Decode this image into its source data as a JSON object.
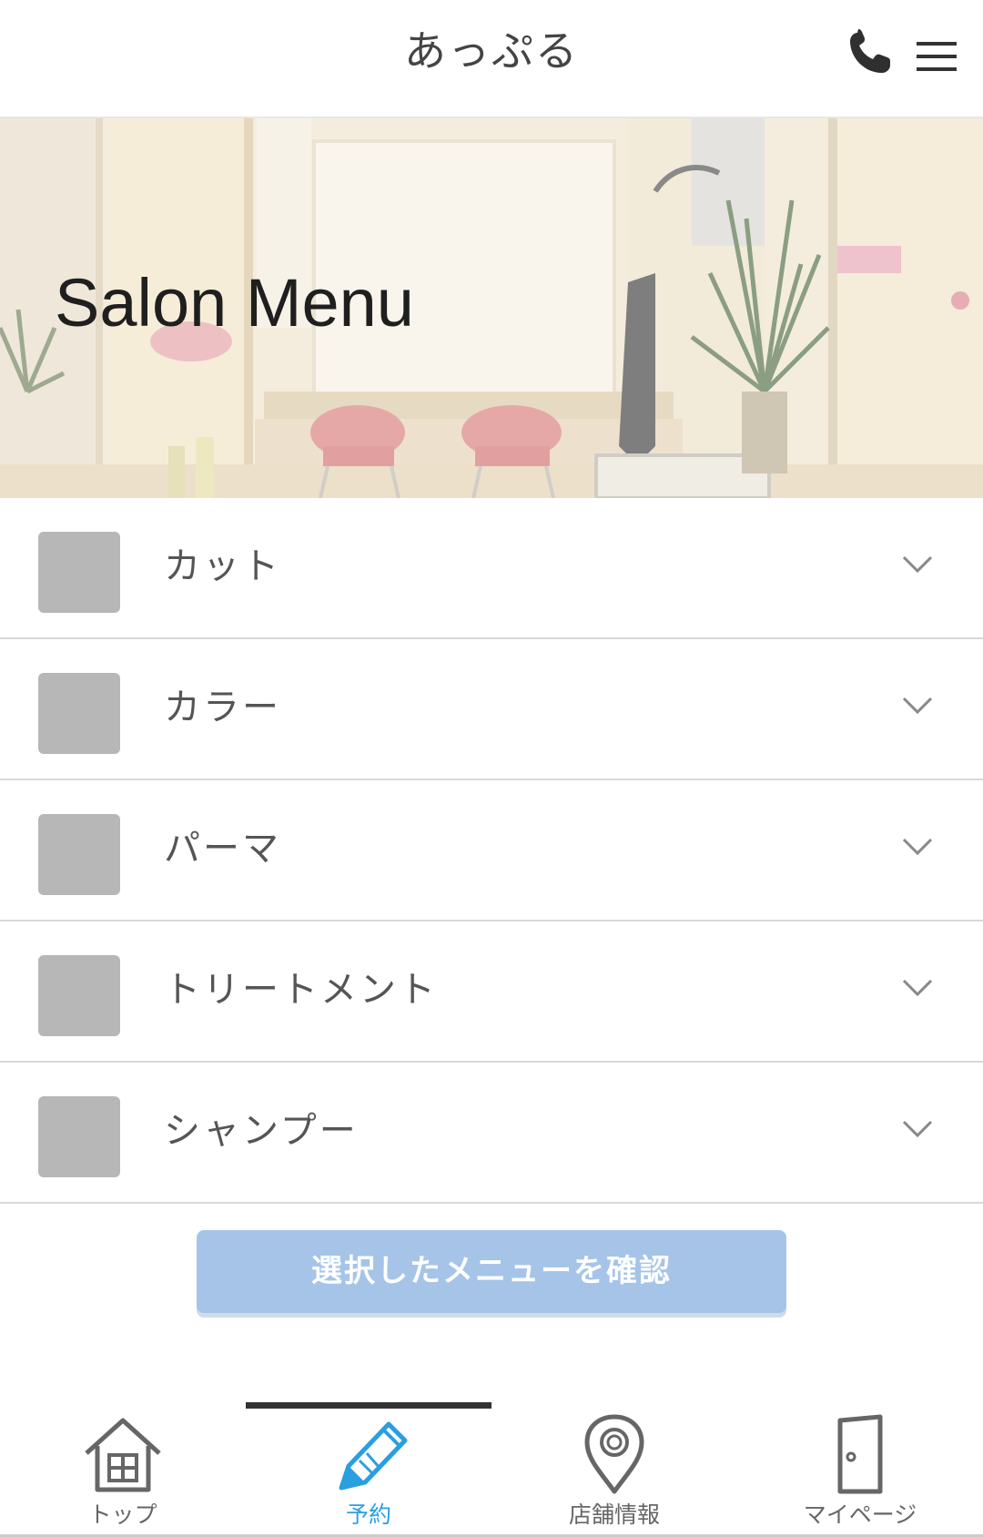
{
  "header": {
    "title": "あっぷる",
    "phone_icon": "phone-icon",
    "menu_icon": "hamburger-menu-icon"
  },
  "hero": {
    "title": "Salon Menu"
  },
  "menu": {
    "items": [
      {
        "label": "カット"
      },
      {
        "label": "カラー"
      },
      {
        "label": "パーマ"
      },
      {
        "label": "トリートメント"
      },
      {
        "label": "シャンプー"
      }
    ],
    "expand_icon": "chevron-down-icon"
  },
  "confirm": {
    "label": "選択したメニューを確認"
  },
  "tabs": [
    {
      "label": "トップ",
      "icon": "home-icon",
      "active": false
    },
    {
      "label": "予約",
      "icon": "pencil-icon",
      "active": true
    },
    {
      "label": "店舗情報",
      "icon": "map-pin-icon",
      "active": false
    },
    {
      "label": "マイページ",
      "icon": "door-icon",
      "active": false
    }
  ],
  "colors": {
    "accent": "#2a9fe0",
    "button": "#a6c4e8",
    "thumbnail": "#b7b7b7",
    "text": "#555555"
  }
}
